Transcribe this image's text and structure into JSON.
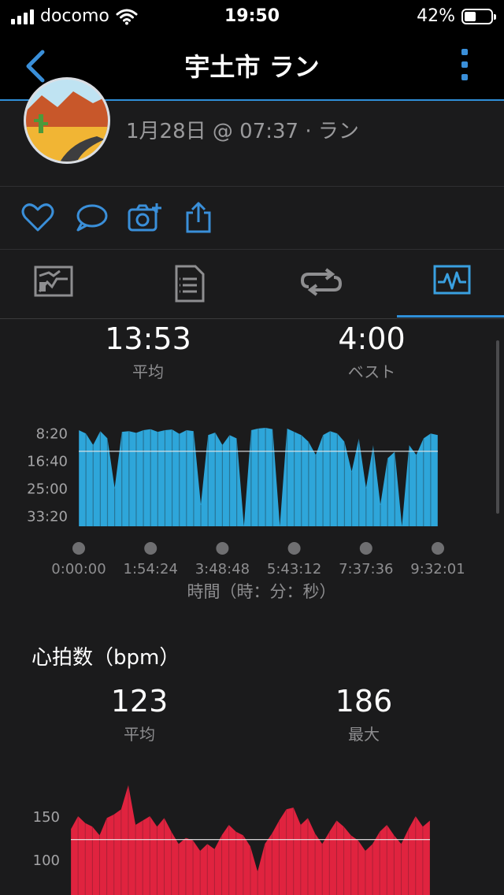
{
  "status_bar": {
    "carrier": "docomo",
    "time": "19:50",
    "battery": "42%"
  },
  "nav": {
    "title": "宇土市 ラン"
  },
  "activity": {
    "meta": "1月28日 @ 07:37 · ラン"
  },
  "pace": {
    "avg_value": "13:53",
    "avg_label": "平均",
    "best_value": "4:00",
    "best_label": "ベスト"
  },
  "heart": {
    "title": "心拍数（bpm）",
    "avg_value": "123",
    "avg_label": "平均",
    "max_value": "186",
    "max_label": "最大"
  },
  "chart_data": [
    {
      "type": "area",
      "color": "#2ea6da",
      "xlabel": "時間（時：分：秒）",
      "x_ticks": [
        "0:00:00",
        "1:54:24",
        "3:48:48",
        "5:43:12",
        "7:37:36",
        "9:32:01"
      ],
      "y_ticks": [
        "8:20",
        "16:40",
        "25:00",
        "33:20"
      ],
      "y_reversed": true,
      "ylim_minutes": [
        5.6,
        36.5
      ],
      "avg_line_minutes": 13.88,
      "x": [
        0,
        0.02,
        0.04,
        0.06,
        0.08,
        0.1,
        0.12,
        0.14,
        0.16,
        0.18,
        0.2,
        0.22,
        0.24,
        0.26,
        0.28,
        0.3,
        0.32,
        0.34,
        0.36,
        0.38,
        0.4,
        0.42,
        0.44,
        0.46,
        0.48,
        0.5,
        0.52,
        0.54,
        0.56,
        0.58,
        0.6,
        0.62,
        0.64,
        0.66,
        0.68,
        0.7,
        0.72,
        0.74,
        0.76,
        0.78,
        0.8,
        0.82,
        0.84,
        0.86,
        0.88,
        0.9,
        0.92,
        0.94,
        0.96,
        0.98,
        1.0
      ],
      "values_minutes": [
        7.5,
        8.5,
        12,
        7.8,
        10,
        25,
        8,
        7.8,
        8.3,
        7.5,
        7.2,
        8,
        7.5,
        7.3,
        8.6,
        7.5,
        7.8,
        30,
        9,
        8.2,
        12,
        9,
        10,
        36.5,
        7.5,
        7,
        6.8,
        7.2,
        36.5,
        7,
        8,
        9,
        11,
        15,
        9,
        7.8,
        8.5,
        11,
        20,
        10,
        25,
        12,
        30,
        16,
        14,
        36.5,
        12,
        15,
        10,
        8.5,
        9
      ]
    },
    {
      "type": "area",
      "color": "#e0233f",
      "y_ticks": [
        150,
        100
      ],
      "avg_line": 123,
      "x": [
        0,
        0.02,
        0.04,
        0.06,
        0.08,
        0.1,
        0.12,
        0.14,
        0.16,
        0.18,
        0.2,
        0.22,
        0.24,
        0.26,
        0.28,
        0.3,
        0.32,
        0.34,
        0.36,
        0.38,
        0.4,
        0.42,
        0.44,
        0.46,
        0.48,
        0.5,
        0.52,
        0.54,
        0.56,
        0.58,
        0.6,
        0.62,
        0.64,
        0.66,
        0.68,
        0.7,
        0.72,
        0.74,
        0.76,
        0.78,
        0.8,
        0.82,
        0.84,
        0.86,
        0.88,
        0.9,
        0.92,
        0.94,
        0.96,
        0.98,
        1.0
      ],
      "values": [
        135,
        150,
        142,
        138,
        128,
        148,
        152,
        158,
        186,
        140,
        145,
        150,
        138,
        148,
        132,
        118,
        125,
        122,
        110,
        118,
        112,
        128,
        140,
        132,
        128,
        115,
        86,
        118,
        130,
        145,
        158,
        160,
        140,
        148,
        130,
        118,
        132,
        145,
        138,
        128,
        122,
        110,
        118,
        132,
        140,
        128,
        118,
        135,
        150,
        138,
        145
      ]
    }
  ]
}
